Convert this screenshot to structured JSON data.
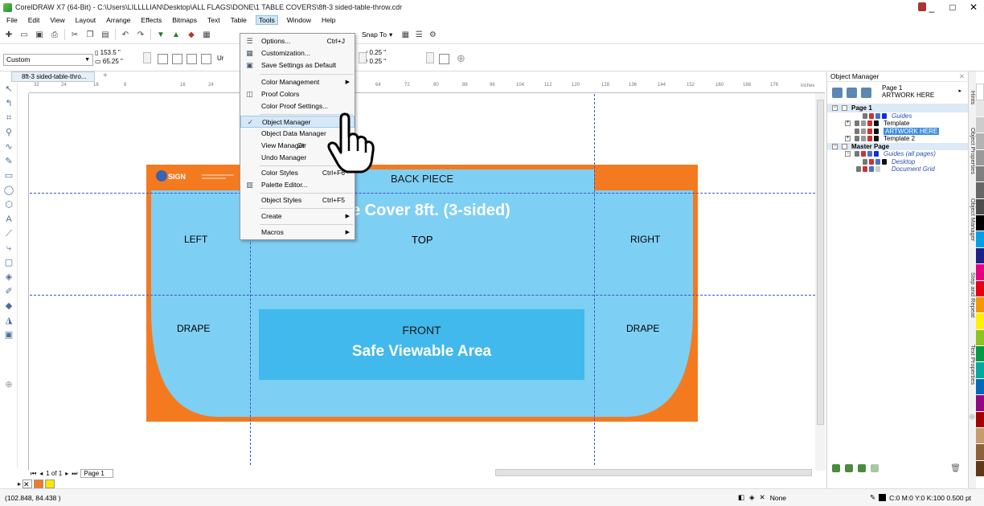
{
  "window": {
    "title": "CorelDRAW X7 (64-Bit) - C:\\Users\\LILLLLIAN\\Desktop\\ALL FLAGS\\DONE\\1 TABLE COVERS\\8ft-3 sided-table-throw.cdr",
    "controls": [
      "_",
      "□",
      "✕"
    ]
  },
  "menubar": [
    "File",
    "Edit",
    "View",
    "Layout",
    "Arrange",
    "Effects",
    "Bitmaps",
    "Text",
    "Table",
    "Tools",
    "Window",
    "Help"
  ],
  "toolbar": {
    "snap_to": "Snap To"
  },
  "propbar": {
    "page_size": "Custom",
    "width": "153.5 \"",
    "height": "65.25 \"",
    "units_prefix": "Ur",
    "nudge_x": "0.25 \"",
    "nudge_y": "0.25 \""
  },
  "doc_tab": "8ft-3 sided-table-thro...",
  "ruler": {
    "h_ticks": [
      "32",
      "24",
      "16",
      "8",
      "16",
      "24",
      "64",
      "72",
      "80",
      "88",
      "96",
      "104",
      "112",
      "120",
      "128",
      "136",
      "144",
      "152",
      "160",
      "168",
      "176"
    ],
    "units": "inches"
  },
  "artwork": {
    "logo": "SIGN",
    "back_piece": "BACK PIECE",
    "title": "e Cover 8ft. (3-sided)",
    "left": "LEFT",
    "top": "TOP",
    "right": "RIGHT",
    "drape_left": "DRAPE",
    "drape_right": "DRAPE",
    "front": "FRONT",
    "safe_area": "Safe Viewable Area",
    "colors": {
      "orange": "#f47a20",
      "light_blue": "#7ecff4",
      "cyan": "#41b9ec"
    }
  },
  "tools_menu": {
    "items": [
      {
        "label": "Options...",
        "shortcut": "Ctrl+J",
        "icon": "options-icon"
      },
      {
        "label": "Customization...",
        "shortcut": "",
        "icon": "customize-icon"
      },
      {
        "label": "Save Settings as Default",
        "shortcut": "",
        "icon": "save-icon"
      },
      {
        "label": "Color Management",
        "shortcut": "",
        "submenu": true
      },
      {
        "label": "Proof Colors",
        "shortcut": "",
        "icon": "proof-icon"
      },
      {
        "label": "Color Proof Settings...",
        "shortcut": ""
      },
      {
        "label": "Object Manager",
        "shortcut": "",
        "checked": true
      },
      {
        "label": "Object Data Manager",
        "shortcut": ""
      },
      {
        "label": "View Manager",
        "shortcut": "Ctr"
      },
      {
        "label": "Undo Manager",
        "shortcut": ""
      },
      {
        "label": "Color Styles",
        "shortcut": "Ctrl+F6"
      },
      {
        "label": "Palette Editor...",
        "shortcut": "",
        "icon": "palette-icon"
      },
      {
        "label": "Object Styles",
        "shortcut": "Ctrl+F5"
      },
      {
        "label": "Create",
        "shortcut": "",
        "submenu": true
      },
      {
        "label": "Macros",
        "shortcut": "",
        "submenu": true
      }
    ]
  },
  "pager": {
    "count": "1 of 1",
    "tab": "Page 1"
  },
  "status": {
    "coords": "(102.848, 84.438 )",
    "fill": "None",
    "outline": "C:0 M:0 Y:0 K:100 0.500 pt"
  },
  "object_manager": {
    "title": "Object Manager",
    "header_page": "Page 1",
    "header_layer": "ARTWORK HERE",
    "tree": {
      "page1": "Page 1",
      "guides": "Guides",
      "template": "Template",
      "artwork": "ARTWORK HERE",
      "template2": "Template 2",
      "master": "Master Page",
      "guides_all": "Guides (all pages)",
      "desktop": "Desktop",
      "doc_grid": "Document Grid"
    }
  },
  "side_tabs": [
    "Hints",
    "Object Properties",
    "Object Manager",
    "Step and Repeat",
    "Text Properties"
  ]
}
